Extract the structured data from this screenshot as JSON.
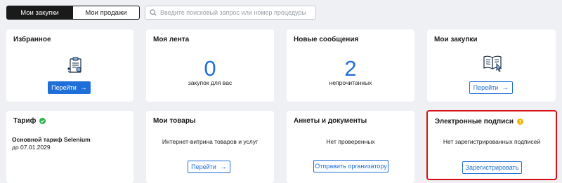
{
  "tabs": {
    "active": "Мои закупки",
    "inactive": "Мои продажи"
  },
  "search": {
    "placeholder": "Введите поисковый запрос или номер процедуры"
  },
  "cards": {
    "favorites": {
      "title": "Избранное",
      "button": "Перейти",
      "icon": "clipboard-document-icon"
    },
    "feed": {
      "title": "Моя лента",
      "count": "0",
      "caption": "закупок для вас"
    },
    "messages": {
      "title": "Новые сообщения",
      "count": "2",
      "caption": "непрочитанных"
    },
    "purchases": {
      "title": "Мои закупки",
      "button": "Перейти",
      "icon": "open-book-icon"
    },
    "tariff": {
      "title": "Тариф",
      "name": "Основной тариф Selenium",
      "until": "до 07.01.2029",
      "status_icon": "check-circle-icon",
      "status_color": "#2eb24c"
    },
    "goods": {
      "title": "Мои товары",
      "caption": "Интернет-витрина товаров и услуг",
      "button": "Перейти"
    },
    "forms": {
      "title": "Анкеты и документы",
      "caption": "Нет проверенных",
      "button": "Отправить организатору"
    },
    "signatures": {
      "title": "Электронные подписи",
      "caption": "Нет зарегистрированных подписей",
      "button": "Зарегистрировать",
      "status_icon": "warning-circle-icon",
      "status_color": "#f5b800",
      "highlight_color": "#d80f16"
    }
  },
  "colors": {
    "accent": "#1f6fd8",
    "background": "#eef0f3"
  }
}
